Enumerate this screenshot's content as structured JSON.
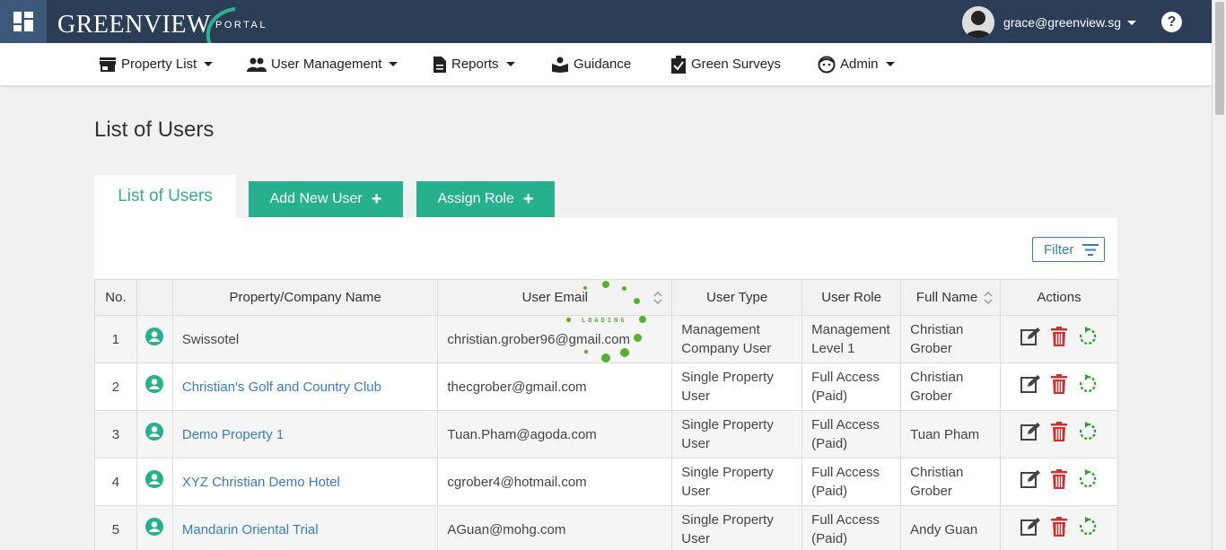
{
  "header": {
    "logo_main": "GREENVIEW",
    "logo_sub": "PORTAL",
    "user_email": "grace@greenview.sg",
    "help_label": "?",
    "colors": {
      "topbar": "#2c3e57",
      "accent": "#26b08c"
    }
  },
  "nav": {
    "items": [
      {
        "label": "Property List",
        "icon": "store-icon",
        "dropdown": true
      },
      {
        "label": "User Management",
        "icon": "people-icon",
        "dropdown": true
      },
      {
        "label": "Reports",
        "icon": "document-icon",
        "dropdown": true
      },
      {
        "label": "Guidance",
        "icon": "book-icon",
        "dropdown": false
      },
      {
        "label": "Green Surveys",
        "icon": "clipboard-check-icon",
        "dropdown": false
      },
      {
        "label": "Admin",
        "icon": "face-icon",
        "dropdown": true
      }
    ]
  },
  "page": {
    "title": "List of Users",
    "tab_label": "List of Users",
    "add_user_label": "Add New User",
    "assign_role_label": "Assign Role",
    "plus": "+",
    "filter_label": "Filter"
  },
  "loader": {
    "text": "LOADING"
  },
  "table": {
    "headers": {
      "no": "No.",
      "property": "Property/Company Name",
      "email": "User Email",
      "type": "User Type",
      "role": "User Role",
      "name": "Full Name",
      "actions": "Actions"
    },
    "rows": [
      {
        "no": "1",
        "property": "Swissotel",
        "email": "christian.grober96@gmail.com",
        "type_1": "Management",
        "type_2": "Company User",
        "role_1": "Management",
        "role_2": "Level 1",
        "name_1": "Christian",
        "name_2": "Grober"
      },
      {
        "no": "2",
        "property": "Christian's Golf and Country Club",
        "email": "thecgrober@gmail.com",
        "type_1": "Single Property",
        "type_2": "User",
        "role_1": "Full Access",
        "role_2": "(Paid)",
        "name_1": "Christian",
        "name_2": "Grober"
      },
      {
        "no": "3",
        "property": "Demo Property 1",
        "email": "Tuan.Pham@agoda.com",
        "type_1": "Single Property",
        "type_2": "User",
        "role_1": "Full Access",
        "role_2": "(Paid)",
        "name_1": "Tuan Pham",
        "name_2": ""
      },
      {
        "no": "4",
        "property": "XYZ Christian Demo Hotel",
        "email": "cgrober4@hotmail.com",
        "type_1": "Single Property",
        "type_2": "User",
        "role_1": "Full Access",
        "role_2": "(Paid)",
        "name_1": "Christian",
        "name_2": "Grober"
      },
      {
        "no": "5",
        "property": "Mandarin Oriental Trial",
        "email": "AGuan@mohg.com",
        "type_1": "Single Property",
        "type_2": "User",
        "role_1": "Full Access",
        "role_2": "(Paid)",
        "name_1": "Andy Guan",
        "name_2": ""
      }
    ]
  }
}
